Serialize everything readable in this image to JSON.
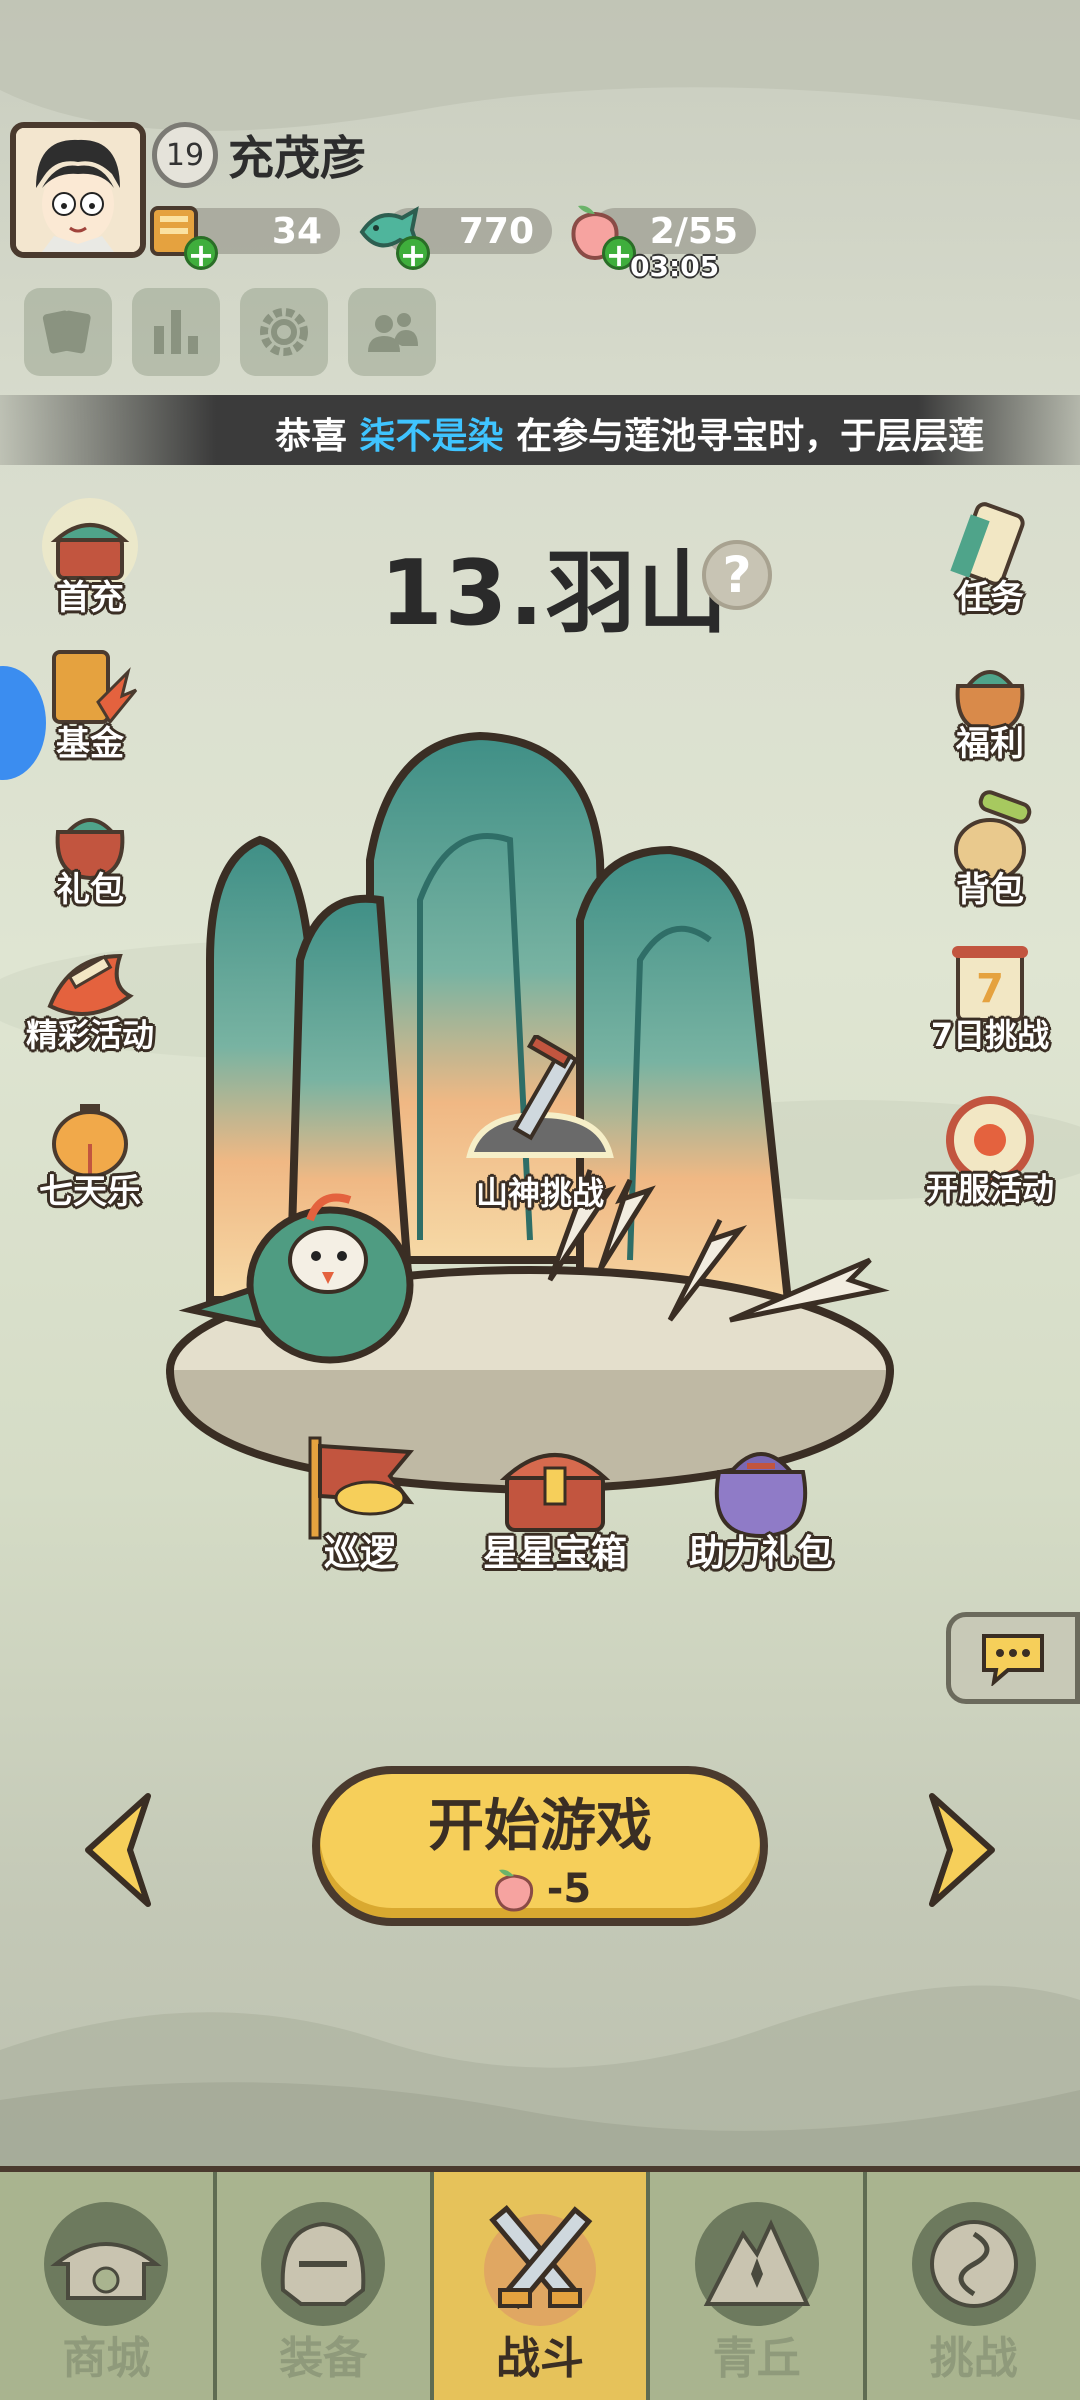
{
  "player": {
    "level": "19",
    "name": "充茂彦"
  },
  "resources": [
    {
      "name": "ticket",
      "value": "34"
    },
    {
      "name": "jade",
      "value": "770"
    },
    {
      "name": "peach-stamina",
      "value": "2/55"
    }
  ],
  "stamina_timer": "03:05",
  "marquee": {
    "prefix": "恭喜 ",
    "highlight": "柒不是染",
    "rest": " 在参与莲池寻宝时，于层层莲"
  },
  "level_title": "13.羽山",
  "left_menu": [
    "首充",
    "基金",
    "礼包",
    "精彩活动",
    "七天乐"
  ],
  "right_menu": [
    "任务",
    "福利",
    "背包",
    "7日挑战",
    "开服活动"
  ],
  "mountain_challenge": "山神挑战",
  "bottom_items": [
    "巡逻",
    "星星宝箱",
    "助力礼包"
  ],
  "start_button": {
    "label": "开始游戏",
    "cost": "-5"
  },
  "nav": [
    {
      "label": "商城",
      "active": false
    },
    {
      "label": "装备",
      "active": false
    },
    {
      "label": "战斗",
      "active": true
    },
    {
      "label": "青丘",
      "active": false
    },
    {
      "label": "挑战",
      "active": false
    }
  ]
}
